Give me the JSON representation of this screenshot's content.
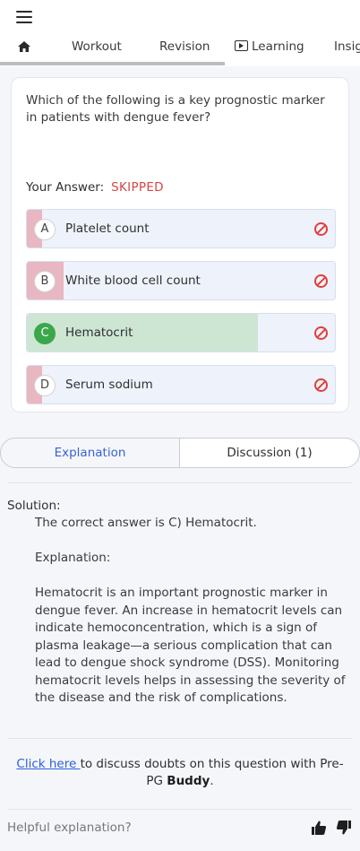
{
  "nav": {
    "menu_icon": "hamburger-icon",
    "home_icon": "home-icon",
    "tabs": [
      "Workout",
      "Revision",
      "Learning",
      "Insights"
    ],
    "learning_icon": "play-screen-icon"
  },
  "question": {
    "text": "Which of the following is a key prognostic marker in patients with dengue fever?",
    "your_answer_label": "Your Answer:",
    "your_answer_status": "SKIPPED",
    "options": [
      {
        "letter": "A",
        "text": "Platelet count",
        "percent": 5
      },
      {
        "letter": "B",
        "text": "White blood cell count",
        "percent": 12
      },
      {
        "letter": "C",
        "text": "Hematocrit",
        "percent": 75,
        "correct": true
      },
      {
        "letter": "D",
        "text": "Serum sodium",
        "percent": 5
      }
    ]
  },
  "explain_tabs": {
    "explanation": "Explanation",
    "discussion": "Discussion (1)"
  },
  "solution": {
    "title": "Solution:",
    "correct_line": "The correct answer is C) Hematocrit.",
    "explanation_heading": "Explanation:",
    "explanation_text": "Hematocrit is an important prognostic marker in dengue fever. An increase in hematocrit levels can indicate hemoconcentration, which is a sign of plasma leakage—a serious complication that can lead to dengue shock syndrome (DSS). Monitoring hematocrit levels helps in assessing the severity of the disease and the risk of complications."
  },
  "discuss": {
    "link": "Click here ",
    "text": "to discuss doubts on this question with Pre-PG ",
    "brand": "Buddy",
    "end": "."
  },
  "feedback": {
    "prompt": "Helpful explanation?",
    "up_icon": "thumbs-up-icon",
    "down_icon": "thumbs-down-icon"
  },
  "colors": {
    "accent": "#3a62d6",
    "skipped": "#d64545",
    "correct_fill": "#cde6d4",
    "wrong_fill": "#e8b7c1",
    "correct_badge": "#3aa84a",
    "no_entry": "#e0403a"
  }
}
